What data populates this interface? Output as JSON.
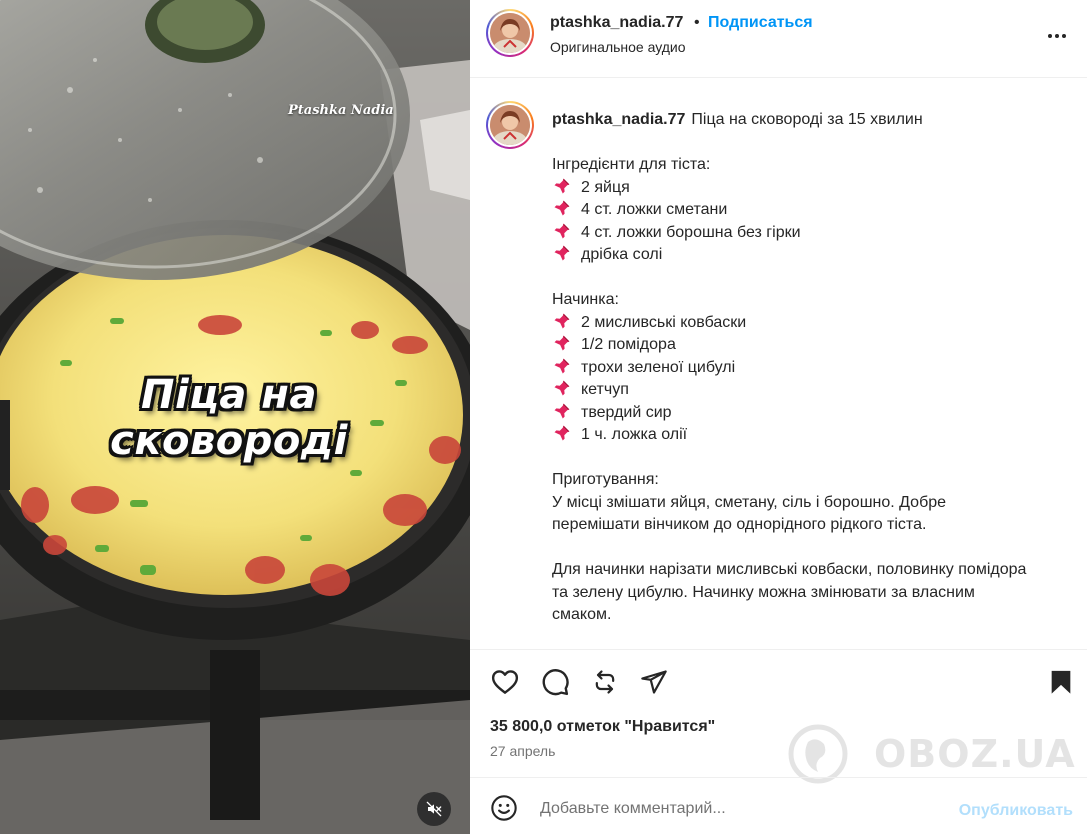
{
  "media": {
    "watermark": "Ptashka Nadia",
    "overlay_line1": "Піца на",
    "overlay_line2": "сковороді",
    "mute_icon": "speaker-muted-icon"
  },
  "header": {
    "username": "ptashka_nadia.77",
    "separator": "•",
    "follow_label": "Подписаться",
    "audio": "Оригинальное аудио",
    "more_icon": "more-options-icon"
  },
  "caption": {
    "username": "ptashka_nadia.77",
    "title": "Піца на сковороді за 15 хвилин",
    "dough_heading": "Інгредієнти для тіста:",
    "dough_items": [
      "2 яйця",
      "4 ст. ложки сметани",
      "4 ст. ложки борошна без гірки",
      "дрібка солі"
    ],
    "filling_heading": "Начинка:",
    "filling_items": [
      "2 мисливські ковбаски",
      "1/2 помідора",
      "трохи зеленої цибулі",
      "кетчуп",
      "твердий сир",
      "1 ч. ложка олії"
    ],
    "prep_heading": "Приготування:",
    "prep_p1_line1": "У місці змішати яйця, сметану, сіль і борошно. Добре",
    "prep_p1_line2": "перемішати вінчиком до однорідного рідкого тіста.",
    "prep_p2_line1": "Для начинки нарізати мисливські ковбаски, половинку помідора",
    "prep_p2_line2": "та зелену цибулю. Начинку можна змінювати за власним",
    "prep_p2_line3": "смаком."
  },
  "actions": {
    "like_icon": "heart-icon",
    "comment_icon": "comment-icon",
    "repost_icon": "repost-icon",
    "share_icon": "share-icon",
    "save_icon": "bookmark-icon"
  },
  "likes": "35 800,0 отметок \"Нравится\"",
  "date": "27 апрель",
  "comment": {
    "emoji_icon": "emoji-icon",
    "placeholder": "Добавьте комментарий...",
    "publish_label": "Опубликовать"
  },
  "site_watermark": "OBOZ.UA",
  "colors": {
    "accent": "#0095f6",
    "publish_disabled": "#b2dffc",
    "text": "#262626",
    "muted": "#737373",
    "pin": "#e0245e"
  }
}
